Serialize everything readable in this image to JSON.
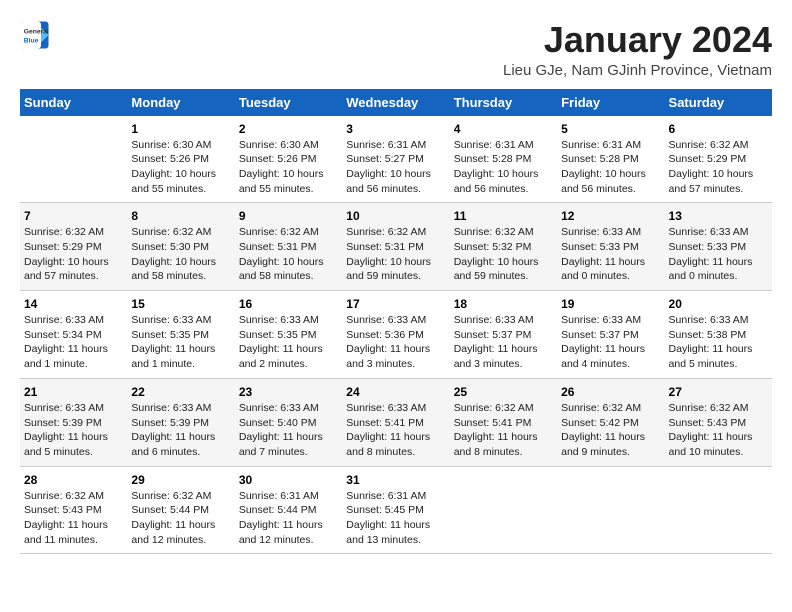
{
  "header": {
    "logo_general": "General",
    "logo_blue": "Blue",
    "title": "January 2024",
    "subtitle": "Lieu GJe, Nam GJinh Province, Vietnam"
  },
  "weekdays": [
    "Sunday",
    "Monday",
    "Tuesday",
    "Wednesday",
    "Thursday",
    "Friday",
    "Saturday"
  ],
  "weeks": [
    [
      {
        "day": "",
        "info": ""
      },
      {
        "day": "1",
        "info": "Sunrise: 6:30 AM\nSunset: 5:26 PM\nDaylight: 10 hours\nand 55 minutes."
      },
      {
        "day": "2",
        "info": "Sunrise: 6:30 AM\nSunset: 5:26 PM\nDaylight: 10 hours\nand 55 minutes."
      },
      {
        "day": "3",
        "info": "Sunrise: 6:31 AM\nSunset: 5:27 PM\nDaylight: 10 hours\nand 56 minutes."
      },
      {
        "day": "4",
        "info": "Sunrise: 6:31 AM\nSunset: 5:28 PM\nDaylight: 10 hours\nand 56 minutes."
      },
      {
        "day": "5",
        "info": "Sunrise: 6:31 AM\nSunset: 5:28 PM\nDaylight: 10 hours\nand 56 minutes."
      },
      {
        "day": "6",
        "info": "Sunrise: 6:32 AM\nSunset: 5:29 PM\nDaylight: 10 hours\nand 57 minutes."
      }
    ],
    [
      {
        "day": "7",
        "info": "Sunrise: 6:32 AM\nSunset: 5:29 PM\nDaylight: 10 hours\nand 57 minutes."
      },
      {
        "day": "8",
        "info": "Sunrise: 6:32 AM\nSunset: 5:30 PM\nDaylight: 10 hours\nand 58 minutes."
      },
      {
        "day": "9",
        "info": "Sunrise: 6:32 AM\nSunset: 5:31 PM\nDaylight: 10 hours\nand 58 minutes."
      },
      {
        "day": "10",
        "info": "Sunrise: 6:32 AM\nSunset: 5:31 PM\nDaylight: 10 hours\nand 59 minutes."
      },
      {
        "day": "11",
        "info": "Sunrise: 6:32 AM\nSunset: 5:32 PM\nDaylight: 10 hours\nand 59 minutes."
      },
      {
        "day": "12",
        "info": "Sunrise: 6:33 AM\nSunset: 5:33 PM\nDaylight: 11 hours\nand 0 minutes."
      },
      {
        "day": "13",
        "info": "Sunrise: 6:33 AM\nSunset: 5:33 PM\nDaylight: 11 hours\nand 0 minutes."
      }
    ],
    [
      {
        "day": "14",
        "info": "Sunrise: 6:33 AM\nSunset: 5:34 PM\nDaylight: 11 hours\nand 1 minute."
      },
      {
        "day": "15",
        "info": "Sunrise: 6:33 AM\nSunset: 5:35 PM\nDaylight: 11 hours\nand 1 minute."
      },
      {
        "day": "16",
        "info": "Sunrise: 6:33 AM\nSunset: 5:35 PM\nDaylight: 11 hours\nand 2 minutes."
      },
      {
        "day": "17",
        "info": "Sunrise: 6:33 AM\nSunset: 5:36 PM\nDaylight: 11 hours\nand 3 minutes."
      },
      {
        "day": "18",
        "info": "Sunrise: 6:33 AM\nSunset: 5:37 PM\nDaylight: 11 hours\nand 3 minutes."
      },
      {
        "day": "19",
        "info": "Sunrise: 6:33 AM\nSunset: 5:37 PM\nDaylight: 11 hours\nand 4 minutes."
      },
      {
        "day": "20",
        "info": "Sunrise: 6:33 AM\nSunset: 5:38 PM\nDaylight: 11 hours\nand 5 minutes."
      }
    ],
    [
      {
        "day": "21",
        "info": "Sunrise: 6:33 AM\nSunset: 5:39 PM\nDaylight: 11 hours\nand 5 minutes."
      },
      {
        "day": "22",
        "info": "Sunrise: 6:33 AM\nSunset: 5:39 PM\nDaylight: 11 hours\nand 6 minutes."
      },
      {
        "day": "23",
        "info": "Sunrise: 6:33 AM\nSunset: 5:40 PM\nDaylight: 11 hours\nand 7 minutes."
      },
      {
        "day": "24",
        "info": "Sunrise: 6:33 AM\nSunset: 5:41 PM\nDaylight: 11 hours\nand 8 minutes."
      },
      {
        "day": "25",
        "info": "Sunrise: 6:32 AM\nSunset: 5:41 PM\nDaylight: 11 hours\nand 8 minutes."
      },
      {
        "day": "26",
        "info": "Sunrise: 6:32 AM\nSunset: 5:42 PM\nDaylight: 11 hours\nand 9 minutes."
      },
      {
        "day": "27",
        "info": "Sunrise: 6:32 AM\nSunset: 5:43 PM\nDaylight: 11 hours\nand 10 minutes."
      }
    ],
    [
      {
        "day": "28",
        "info": "Sunrise: 6:32 AM\nSunset: 5:43 PM\nDaylight: 11 hours\nand 11 minutes."
      },
      {
        "day": "29",
        "info": "Sunrise: 6:32 AM\nSunset: 5:44 PM\nDaylight: 11 hours\nand 12 minutes."
      },
      {
        "day": "30",
        "info": "Sunrise: 6:31 AM\nSunset: 5:44 PM\nDaylight: 11 hours\nand 12 minutes."
      },
      {
        "day": "31",
        "info": "Sunrise: 6:31 AM\nSunset: 5:45 PM\nDaylight: 11 hours\nand 13 minutes."
      },
      {
        "day": "",
        "info": ""
      },
      {
        "day": "",
        "info": ""
      },
      {
        "day": "",
        "info": ""
      }
    ]
  ]
}
